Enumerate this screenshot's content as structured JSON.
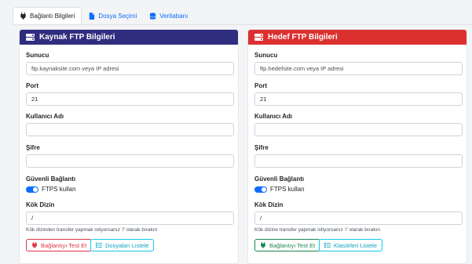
{
  "tabs": [
    {
      "label": "Bağlantı Bilgileri",
      "active": true,
      "icon": "plug-icon"
    },
    {
      "label": "Dosya Seçimi",
      "active": false,
      "icon": "file-icon"
    },
    {
      "label": "Veritabanı",
      "active": false,
      "icon": "database-icon"
    }
  ],
  "colors": {
    "source_header": "#2f2d7e",
    "target_header": "#dc3030",
    "primary": "#0d6efd",
    "danger": "#dc3545",
    "success": "#198754",
    "info": "#0dcaf0"
  },
  "source": {
    "title": "Kaynak FTP Bilgileri",
    "host_label": "Sunucu",
    "host_placeholder": "ftp.kaynaksite.com veya IP adresi",
    "port_label": "Port",
    "port_value": "21",
    "user_label": "Kullanıcı Adı",
    "password_label": "Şifre",
    "secure_label": "Güvenli Bağlantı",
    "ftps_label": "FTPS kullan",
    "root_label": "Kök Dizin",
    "root_value": "/",
    "root_hint": "Kök dizinden transfer yapmak istiyorsanız '/' olarak bırakın",
    "test_button": "Bağlantıyı Test Et",
    "list_button": "Dosyaları Listele"
  },
  "target": {
    "title": "Hedef FTP Bilgileri",
    "host_label": "Sunucu",
    "host_placeholder": "ftp.hedefsite.com veya IP adresi",
    "port_label": "Port",
    "port_value": "21",
    "user_label": "Kullanıcı Adı",
    "password_label": "Şifre",
    "secure_label": "Güvenli Bağlantı",
    "ftps_label": "FTPS kullan",
    "root_label": "Kök Dizin",
    "root_value": "/",
    "root_hint": "Kök dizine transfer yapmak istiyorsanız '/' olarak bırakın",
    "test_button": "Bağlantıyı Test Et",
    "list_button": "Klasörleri Listele"
  }
}
